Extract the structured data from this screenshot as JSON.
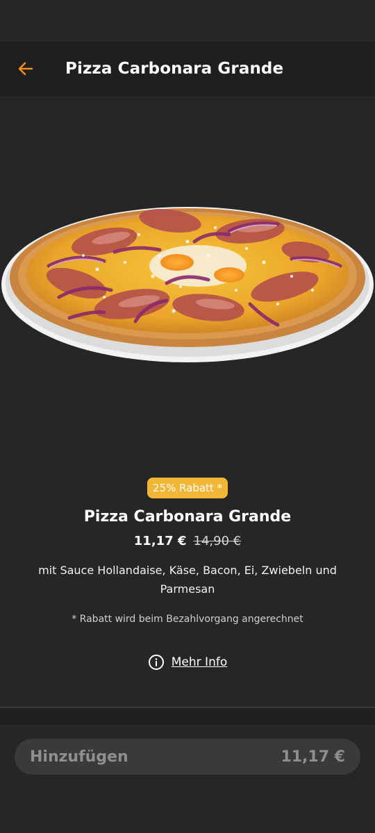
{
  "header": {
    "title": "Pizza Carbonara Grande",
    "back_icon": "arrow-left-icon",
    "accent_color": "#f28c1b"
  },
  "product": {
    "image_icon": "pizza-image",
    "badge": "25% Rabatt *",
    "badge_color": "#f3b636",
    "title": "Pizza Carbonara Grande",
    "price_current": "11,17 €",
    "price_original": "14,90 €",
    "description": "mit Sauce Hollandaise, Käse, Bacon, Ei, Zwiebeln und Parmesan",
    "footnote": "* Rabatt wird beim Bezahlvorgang angerechnet",
    "more_info_icon": "info-circle-icon",
    "more_info_label": "Mehr Info"
  },
  "footer": {
    "add_label": "Hinzufügen",
    "add_price": "11,17 €"
  }
}
